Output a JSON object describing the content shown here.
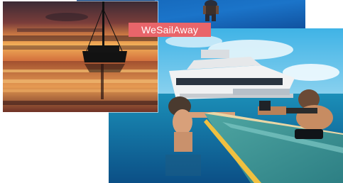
{
  "brand": {
    "label": "WeSailAway",
    "badge_color": "#e9656a"
  },
  "photos": [
    {
      "subject": "underwater-swimmer"
    },
    {
      "subject": "catamaran-at-sunset"
    },
    {
      "subject": "couple-on-paddle-board-by-yacht"
    }
  ]
}
